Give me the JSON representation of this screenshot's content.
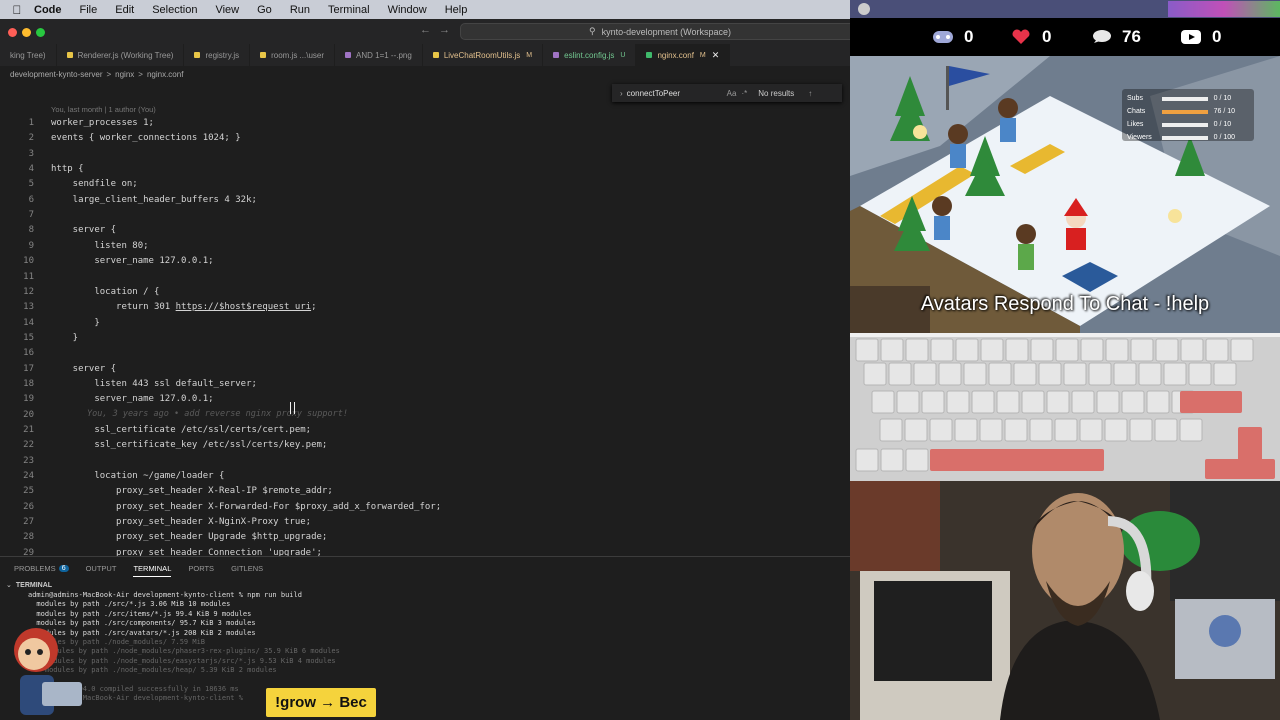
{
  "menubar": {
    "app": "Code",
    "items": [
      "File",
      "Edit",
      "Selection",
      "View",
      "Go",
      "Run",
      "Terminal",
      "Window",
      "Help"
    ]
  },
  "window": {
    "workspace_title": "kynto-development (Workspace)"
  },
  "tabs": [
    {
      "label": "king Tree)",
      "status": "",
      "color": "#888888"
    },
    {
      "label": "Renderer.js (Working Tree)",
      "status": "",
      "color": "#e8c547"
    },
    {
      "label": "registry.js",
      "status": "",
      "color": "#e8c547"
    },
    {
      "label": "room.js ...\\user",
      "status": "",
      "color": "#e8c547"
    },
    {
      "label": "AND 1=1 --.png",
      "status": "",
      "color": "#a074c4"
    },
    {
      "label": "LiveChatRoomUtils.js",
      "status": "M",
      "color": "#e8c547"
    },
    {
      "label": "eslint.config.js",
      "status": "U",
      "color": "#a074c4"
    },
    {
      "label": "nginx.conf",
      "status": "M",
      "color": "#3fb96b",
      "active": true
    }
  ],
  "breadcrumb": [
    "development-kynto-server",
    ">",
    "nginx",
    ">",
    "nginx.conf"
  ],
  "find": {
    "query": "connectToPeer",
    "option": "Aa",
    "result": "No results"
  },
  "editor": {
    "blame_header": "You, last month | 1 author (You)",
    "lines": [
      {
        "n": "1",
        "text": "worker_processes 1;"
      },
      {
        "n": "2",
        "text": "events { worker_connections 1024; }"
      },
      {
        "n": "3",
        "text": ""
      },
      {
        "n": "4",
        "text": "http {"
      },
      {
        "n": "5",
        "text": "    sendfile on;"
      },
      {
        "n": "6",
        "text": "    large_client_header_buffers 4 32k;"
      },
      {
        "n": "7",
        "text": ""
      },
      {
        "n": "8",
        "text": "    server {"
      },
      {
        "n": "9",
        "text": "        listen 80;"
      },
      {
        "n": "10",
        "text": "        server_name 127.0.0.1;"
      },
      {
        "n": "11",
        "text": ""
      },
      {
        "n": "12",
        "text": "        location / {"
      },
      {
        "n": "13",
        "text": "            return 301 https://$host$request_uri;"
      },
      {
        "n": "14",
        "text": "        }"
      },
      {
        "n": "15",
        "text": "    }"
      },
      {
        "n": "16",
        "text": ""
      },
      {
        "n": "17",
        "text": "    server {"
      },
      {
        "n": "18",
        "text": "        listen 443 ssl default_server;"
      },
      {
        "n": "19",
        "text": "        server_name 127.0.0.1;"
      },
      {
        "n": "20",
        "text": ""
      },
      {
        "n": "21",
        "text": "        ssl_certificate /etc/ssl/certs/cert.pem;"
      },
      {
        "n": "22",
        "text": "        ssl_certificate_key /etc/ssl/certs/key.pem;"
      },
      {
        "n": "23",
        "text": ""
      },
      {
        "n": "24",
        "text": "        location ~/game/loader {"
      },
      {
        "n": "25",
        "text": "            proxy_set_header X-Real-IP $remote_addr;"
      },
      {
        "n": "26",
        "text": "            proxy_set_header X-Forwarded-For $proxy_add_x_forwarded_for;"
      },
      {
        "n": "27",
        "text": "            proxy_set_header X-NginX-Proxy true;"
      },
      {
        "n": "28",
        "text": "            proxy_set_header Upgrade $http_upgrade;"
      },
      {
        "n": "29",
        "text": "            proxy_set_header Connection 'upgrade';"
      }
    ],
    "ghost_text": "You, 3 years ago • add reverse nginx proxy support!"
  },
  "panel": {
    "tabs": [
      "PROBLEMS",
      "OUTPUT",
      "TERMINAL",
      "PORTS",
      "GITLENS"
    ],
    "problems_count": "6",
    "active_tab": "TERMINAL",
    "terminal_header": "TERMINAL",
    "terminal_lines": [
      {
        "text": "admin@admins-MacBook-Air development-kynto-client % npm run build",
        "dim": false
      },
      {
        "text": "  modules by path ./src/*.js 3.06 MiB 10 modules",
        "dim": false
      },
      {
        "text": "  modules by path ./src/items/*.js 99.4 KiB 9 modules",
        "dim": false
      },
      {
        "text": "  modules by path ./src/components/ 95.7 KiB 3 modules",
        "dim": false
      },
      {
        "text": "  modules by path ./src/avatars/*.js 208 KiB 2 modules",
        "dim": false
      },
      {
        "text": "  modules by path ./node_modules/ 7.59 MiB",
        "dim": true
      },
      {
        "text": "    modules by path ./node_modules/phaser3-rex-plugins/ 35.9 KiB 6 modules",
        "dim": true
      },
      {
        "text": "    modules by path ./node_modules/easystarjs/src/*.js 9.53 KiB 4 modules",
        "dim": true
      },
      {
        "text": "    modules by path ./node_modules/heap/ 5.39 KiB 2 modules",
        "dim": true
      },
      {
        "text": "",
        "dim": true
      },
      {
        "text": "  webpack 5.94.0 compiled successfully in 18636 ms",
        "dim": true
      },
      {
        "text": "admin@admins-MacBook-Air development-kynto-client %",
        "dim": true
      }
    ]
  },
  "overlay": {
    "promo": "!grow → Bec"
  },
  "game": {
    "stats": [
      {
        "icon": "gamepad-icon",
        "value": "0"
      },
      {
        "icon": "heart-icon",
        "value": "0"
      },
      {
        "icon": "chat-bubble-icon",
        "value": "76"
      },
      {
        "icon": "youtube-icon",
        "value": "0"
      }
    ],
    "meters": [
      {
        "label": "Subs",
        "value": "0 / 10",
        "fraction": 0.0
      },
      {
        "label": "Chats",
        "value": "76 / 10",
        "fraction": 1.0
      },
      {
        "label": "Likes",
        "value": "0 / 10",
        "fraction": 0.0
      },
      {
        "label": "Viewers",
        "value": "0 / 100",
        "fraction": 0.0
      }
    ],
    "caption": "Avatars Respond To Chat - !help"
  },
  "colors": {
    "accent": "#0e639c",
    "promo": "#f5d33c",
    "heart": "#e8334a"
  }
}
